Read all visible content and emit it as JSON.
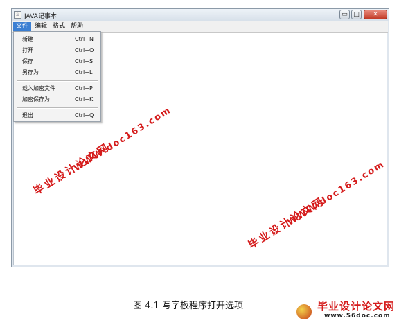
{
  "window": {
    "title": "JAVA记事本",
    "controls": {
      "minimize": "▭",
      "maximize": "□",
      "close": "✕"
    }
  },
  "menubar": {
    "items": [
      {
        "label": "文件",
        "active": true
      },
      {
        "label": "编辑",
        "active": false
      },
      {
        "label": "格式",
        "active": false
      },
      {
        "label": "帮助",
        "active": false
      }
    ]
  },
  "file_menu": {
    "items": [
      {
        "label": "新建",
        "shortcut": "Ctrl+N"
      },
      {
        "label": "打开",
        "shortcut": "Ctrl+O"
      },
      {
        "label": "保存",
        "shortcut": "Ctrl+S"
      },
      {
        "label": "另存为",
        "shortcut": "Ctrl+L"
      },
      {
        "label": "载入加密文件",
        "shortcut": "Ctrl+P"
      },
      {
        "label": "加密保存为",
        "shortcut": "Ctrl+K"
      },
      {
        "label": "退出",
        "shortcut": "Ctrl+Q"
      }
    ]
  },
  "watermark": {
    "cn": "毕业设计论文网",
    "url": "WWW.doc163.com"
  },
  "caption": "图 4.1   写字板程序打开选项",
  "logo": {
    "cn": "毕业设计论文网",
    "url": "www.56doc.com"
  },
  "colors": {
    "menu_active": "#3b7fd3",
    "watermark": "#d51b1b"
  }
}
